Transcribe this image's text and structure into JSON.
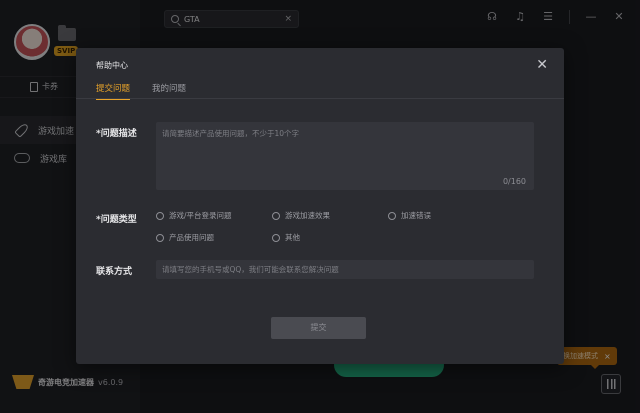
{
  "sidebar": {
    "badge": "SVIP",
    "card_label": "卡券",
    "nav": [
      {
        "label": "游戏加速"
      },
      {
        "label": "游戏库"
      }
    ],
    "brand_name": "奇游电竞加速器",
    "version": "v6.0.9"
  },
  "search": {
    "value": "GTA",
    "clear": "×"
  },
  "main": {
    "accel_button": "",
    "mode_tip": "换加速模式",
    "mode_tip_close": "×"
  },
  "modal": {
    "title": "帮助中心",
    "close": "✕",
    "tabs": [
      {
        "label": "提交问题",
        "active": true
      },
      {
        "label": "我的问题",
        "active": false
      }
    ],
    "description_label": "*问题描述",
    "description_placeholder": "请简要描述产品使用问题，不少于10个字",
    "counter": "0/160",
    "type_label": "*问题类型",
    "types": [
      {
        "label": "游戏/平台登录问题"
      },
      {
        "label": "游戏加速效果"
      },
      {
        "label": "加速错误"
      },
      {
        "label": "产品使用问题"
      },
      {
        "label": "其他"
      }
    ],
    "contact_label": "联系方式",
    "contact_placeholder": "请填写您的手机号或QQ，我们可能会联系您解决问题",
    "submit": "提交"
  },
  "colors": {
    "accent": "#e9a42a",
    "accelerate_green": "#26b381",
    "background": "#1b1c20"
  }
}
